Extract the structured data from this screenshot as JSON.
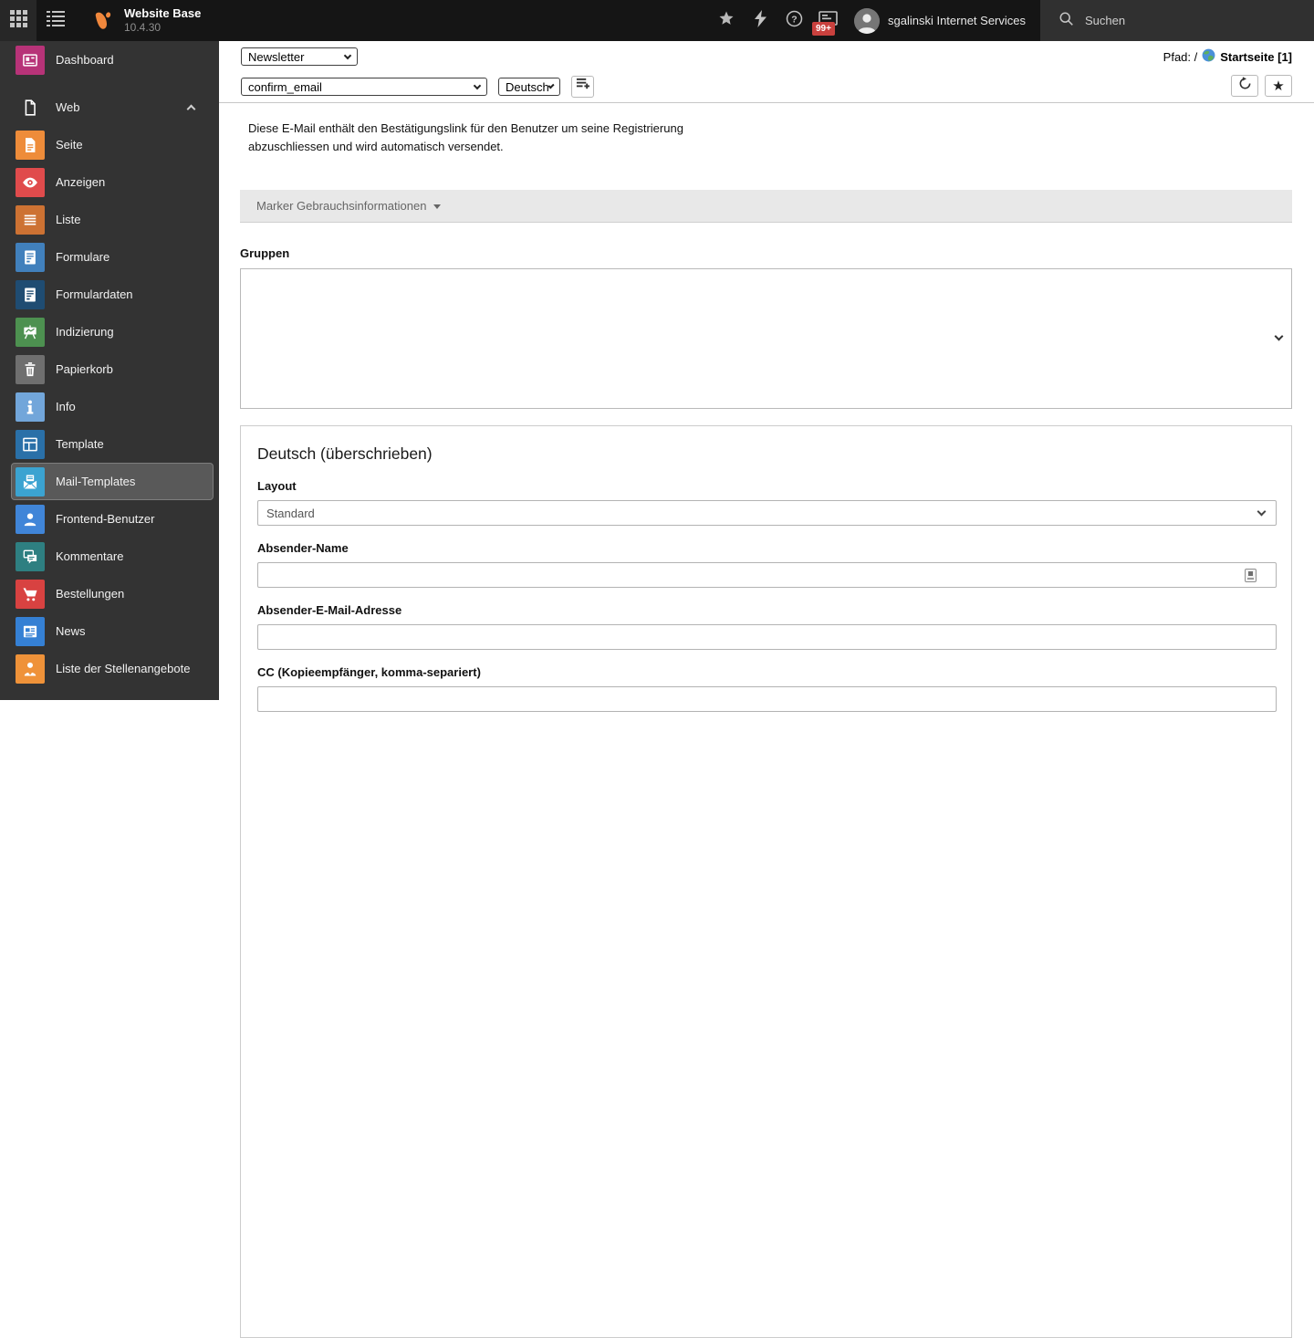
{
  "topbar": {
    "app_title": "Website Base",
    "app_version": "10.4.30",
    "username": "sgalinski Internet Services",
    "search_placeholder": "Suchen",
    "notification_badge": "99+",
    "icons": [
      "modulemenu-grid-icon",
      "toc-list-icon",
      "typo3-logo",
      "bookmarks-star-icon",
      "bolt-icon",
      "help-icon",
      "systeminformation-icon",
      "avatar",
      "search-icon"
    ]
  },
  "sidebar": {
    "items": [
      {
        "label": "Dashboard",
        "icon": "dashboard-icon",
        "color": "#b73378"
      },
      {
        "label": "Web",
        "icon": "web-icon",
        "type": "section",
        "chevron": "up"
      },
      {
        "label": "Seite",
        "icon": "page-icon",
        "color": "#ee8c3a"
      },
      {
        "label": "Anzeigen",
        "icon": "view-icon",
        "color": "#e04b4c"
      },
      {
        "label": "Liste",
        "icon": "list-icon",
        "color": "#cd7233"
      },
      {
        "label": "Formulare",
        "icon": "forms-icon",
        "color": "#4180bc"
      },
      {
        "label": "Formulardaten",
        "icon": "form-data-icon",
        "color": "#1f4c72"
      },
      {
        "label": "Indizierung",
        "icon": "indexing-icon",
        "color": "#4d9150"
      },
      {
        "label": "Papierkorb",
        "icon": "trash-icon",
        "color": "#6f6f6f"
      },
      {
        "label": "Info",
        "icon": "info-icon",
        "color": "#72a6da"
      },
      {
        "label": "Template",
        "icon": "template-icon",
        "color": "#2a70a8"
      },
      {
        "label": "Mail-Templates",
        "icon": "mail-template-icon",
        "color": "#3ba3d1",
        "selected": true
      },
      {
        "label": "Frontend-Benutzer",
        "icon": "user-icon",
        "color": "#4085d8"
      },
      {
        "label": "Kommentare",
        "icon": "comments-icon",
        "color": "#2e7f81"
      },
      {
        "label": "Bestellungen",
        "icon": "cart-icon",
        "color": "#d84241"
      },
      {
        "label": "News",
        "icon": "news-icon",
        "color": "#3580d4"
      },
      {
        "label": "Liste der Stellenangebote",
        "icon": "jobs-icon",
        "color": "#ef9239"
      }
    ]
  },
  "docheader": {
    "template_type_select": "Newsletter",
    "template_select": "confirm_email",
    "language_select": "Deutsch",
    "new_record_icon": "new-record-icon",
    "path_label": "Pfad: /",
    "page_title": "Startseite [1]",
    "buttons": [
      {
        "icon": "refresh-icon"
      },
      {
        "icon": "bookmark-star-icon",
        "glyph": "★"
      }
    ]
  },
  "main": {
    "description": "Diese E-Mail enthält den Bestätigungslink für den Benutzer um seine Registrierung abzuschliessen und wird automatisch versendet.",
    "marker_panel_label": "Marker Gebrauchsinformationen",
    "groups_label": "Gruppen",
    "section": {
      "heading": "Deutsch (überschrieben)",
      "fields": [
        {
          "label": "Layout",
          "type": "select",
          "value": "Standard"
        },
        {
          "label": "Absender-Name",
          "type": "text",
          "value": "",
          "has_picker": true
        },
        {
          "label": "Absender-E-Mail-Adresse",
          "type": "text",
          "value": ""
        },
        {
          "label": "CC (Kopieempfänger, komma-separiert)",
          "type": "text",
          "value": ""
        }
      ]
    }
  }
}
